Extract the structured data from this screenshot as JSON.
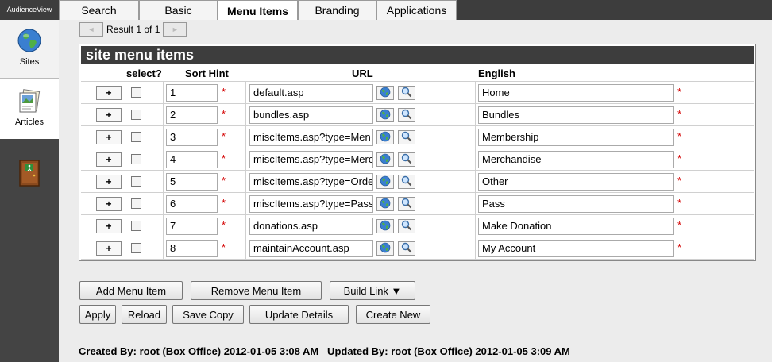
{
  "app": {
    "brand": "AudienceView"
  },
  "tabs": [
    {
      "label": "Search"
    },
    {
      "label": "Basic"
    },
    {
      "label": "Menu Items"
    },
    {
      "label": "Branding"
    },
    {
      "label": "Applications"
    }
  ],
  "sidebar": {
    "sites": "Sites",
    "articles": "Articles"
  },
  "pager": {
    "text": "Result 1 of 1"
  },
  "panel": {
    "title": "site menu items",
    "headers": {
      "select": "select?",
      "sort_hint": "Sort Hint",
      "url": "URL",
      "english": "English"
    },
    "rows": [
      {
        "plus": "+",
        "sort": "1",
        "url": "default.asp",
        "english": "Home",
        "req": "*"
      },
      {
        "plus": "+",
        "sort": "2",
        "url": "bundles.asp",
        "english": "Bundles",
        "req": "*"
      },
      {
        "plus": "+",
        "sort": "3",
        "url": "miscItems.asp?type=Men",
        "english": "Membership",
        "req": "*"
      },
      {
        "plus": "+",
        "sort": "4",
        "url": "miscItems.asp?type=Merc",
        "english": "Merchandise",
        "req": "*"
      },
      {
        "plus": "+",
        "sort": "5",
        "url": "miscItems.asp?type=Orde",
        "english": "Other",
        "req": "*"
      },
      {
        "plus": "+",
        "sort": "6",
        "url": "miscItems.asp?type=Pass",
        "english": "Pass",
        "req": "*"
      },
      {
        "plus": "+",
        "sort": "7",
        "url": "donations.asp",
        "english": "Make Donation",
        "req": "*"
      },
      {
        "plus": "+",
        "sort": "8",
        "url": "maintainAccount.asp",
        "english": "My Account",
        "req": "*"
      }
    ]
  },
  "buttons": {
    "add_menu_item": "Add Menu Item",
    "remove_menu_item": "Remove Menu Item",
    "build_link": "Build Link ▼",
    "apply": "Apply",
    "reload": "Reload",
    "save_copy": "Save Copy",
    "update_details": "Update Details",
    "create_new": "Create New"
  },
  "footer": {
    "info": "Created By: root (Box Office) 2012-01-05 3:08 AM   Updated By: root (Box Office) 2012-01-05 3:09 AM"
  },
  "colors": {
    "dark_bar": "#3d3d3d",
    "required": "#d40000",
    "background": "#ececec"
  }
}
